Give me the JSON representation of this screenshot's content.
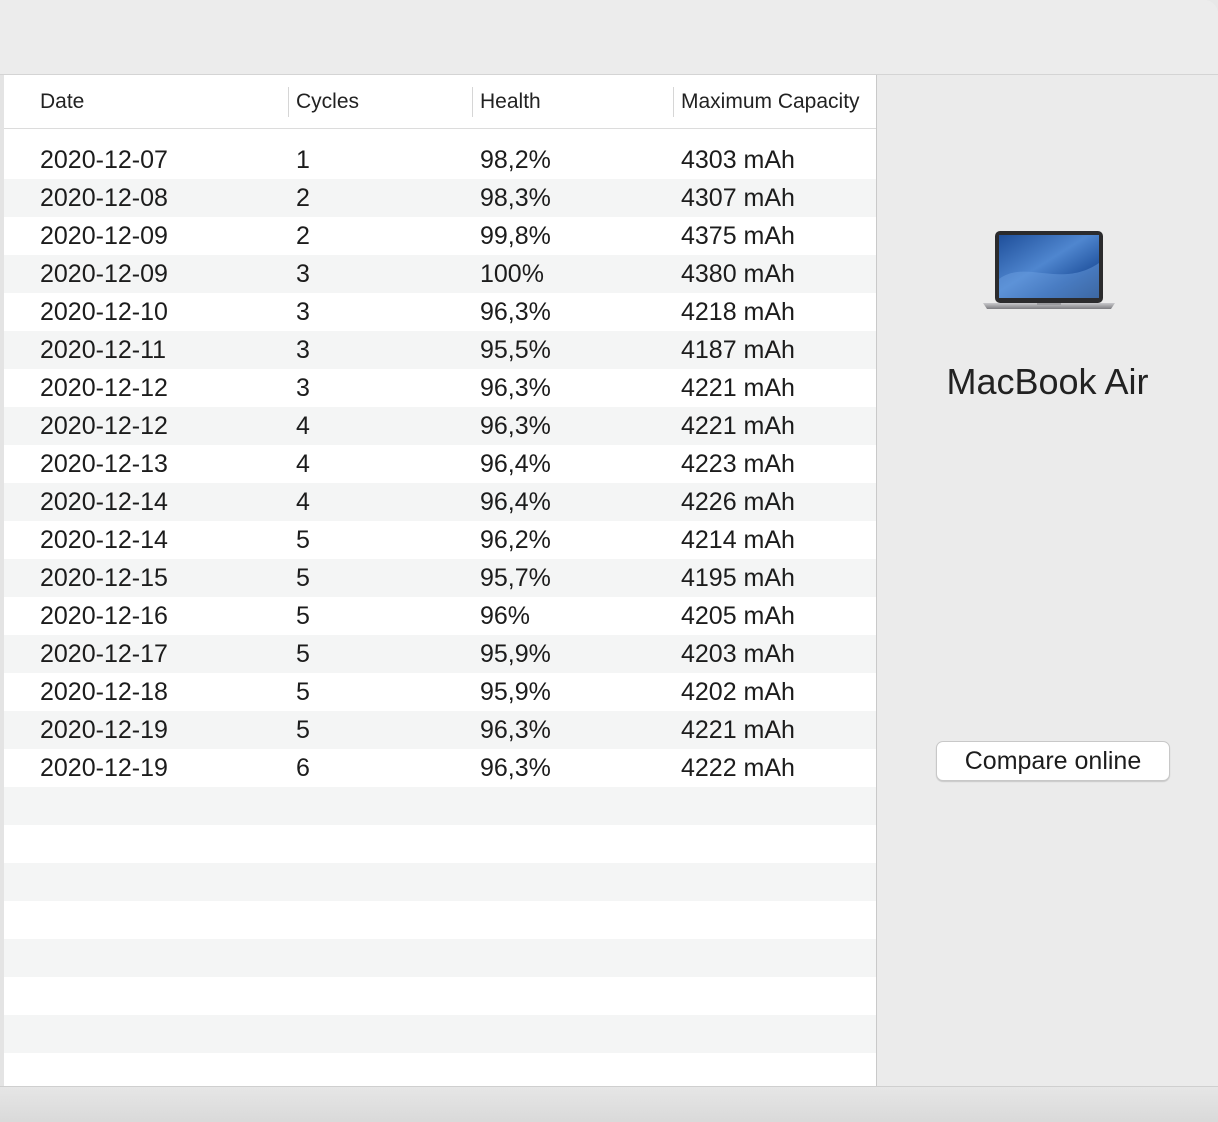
{
  "table": {
    "columns": [
      "Date",
      "Cycles",
      "Health",
      "Maximum Capacity"
    ],
    "rows": [
      [
        "2020-12-07",
        "1",
        "98,2%",
        "4303 mAh"
      ],
      [
        "2020-12-08",
        "2",
        "98,3%",
        "4307 mAh"
      ],
      [
        "2020-12-09",
        "2",
        "99,8%",
        "4375 mAh"
      ],
      [
        "2020-12-09",
        "3",
        "100%",
        "4380 mAh"
      ],
      [
        "2020-12-10",
        "3",
        "96,3%",
        "4218 mAh"
      ],
      [
        "2020-12-11",
        "3",
        "95,5%",
        "4187 mAh"
      ],
      [
        "2020-12-12",
        "3",
        "96,3%",
        "4221 mAh"
      ],
      [
        "2020-12-12",
        "4",
        "96,3%",
        "4221 mAh"
      ],
      [
        "2020-12-13",
        "4",
        "96,4%",
        "4223 mAh"
      ],
      [
        "2020-12-14",
        "4",
        "96,4%",
        "4226 mAh"
      ],
      [
        "2020-12-14",
        "5",
        "96,2%",
        "4214 mAh"
      ],
      [
        "2020-12-15",
        "5",
        "95,7%",
        "4195 mAh"
      ],
      [
        "2020-12-16",
        "5",
        "96%",
        "4205 mAh"
      ],
      [
        "2020-12-17",
        "5",
        "95,9%",
        "4203 mAh"
      ],
      [
        "2020-12-18",
        "5",
        "95,9%",
        "4202 mAh"
      ],
      [
        "2020-12-19",
        "5",
        "96,3%",
        "4221 mAh"
      ],
      [
        "2020-12-19",
        "6",
        "96,3%",
        "4222 mAh"
      ]
    ]
  },
  "sidebar": {
    "device_icon": "macbook-laptop-icon",
    "device_name": "MacBook Air",
    "compare_label": "Compare online"
  },
  "colors": {
    "row_alt": "#f4f5f5",
    "window_bg": "#ececec",
    "text": "#1c1c1c"
  }
}
